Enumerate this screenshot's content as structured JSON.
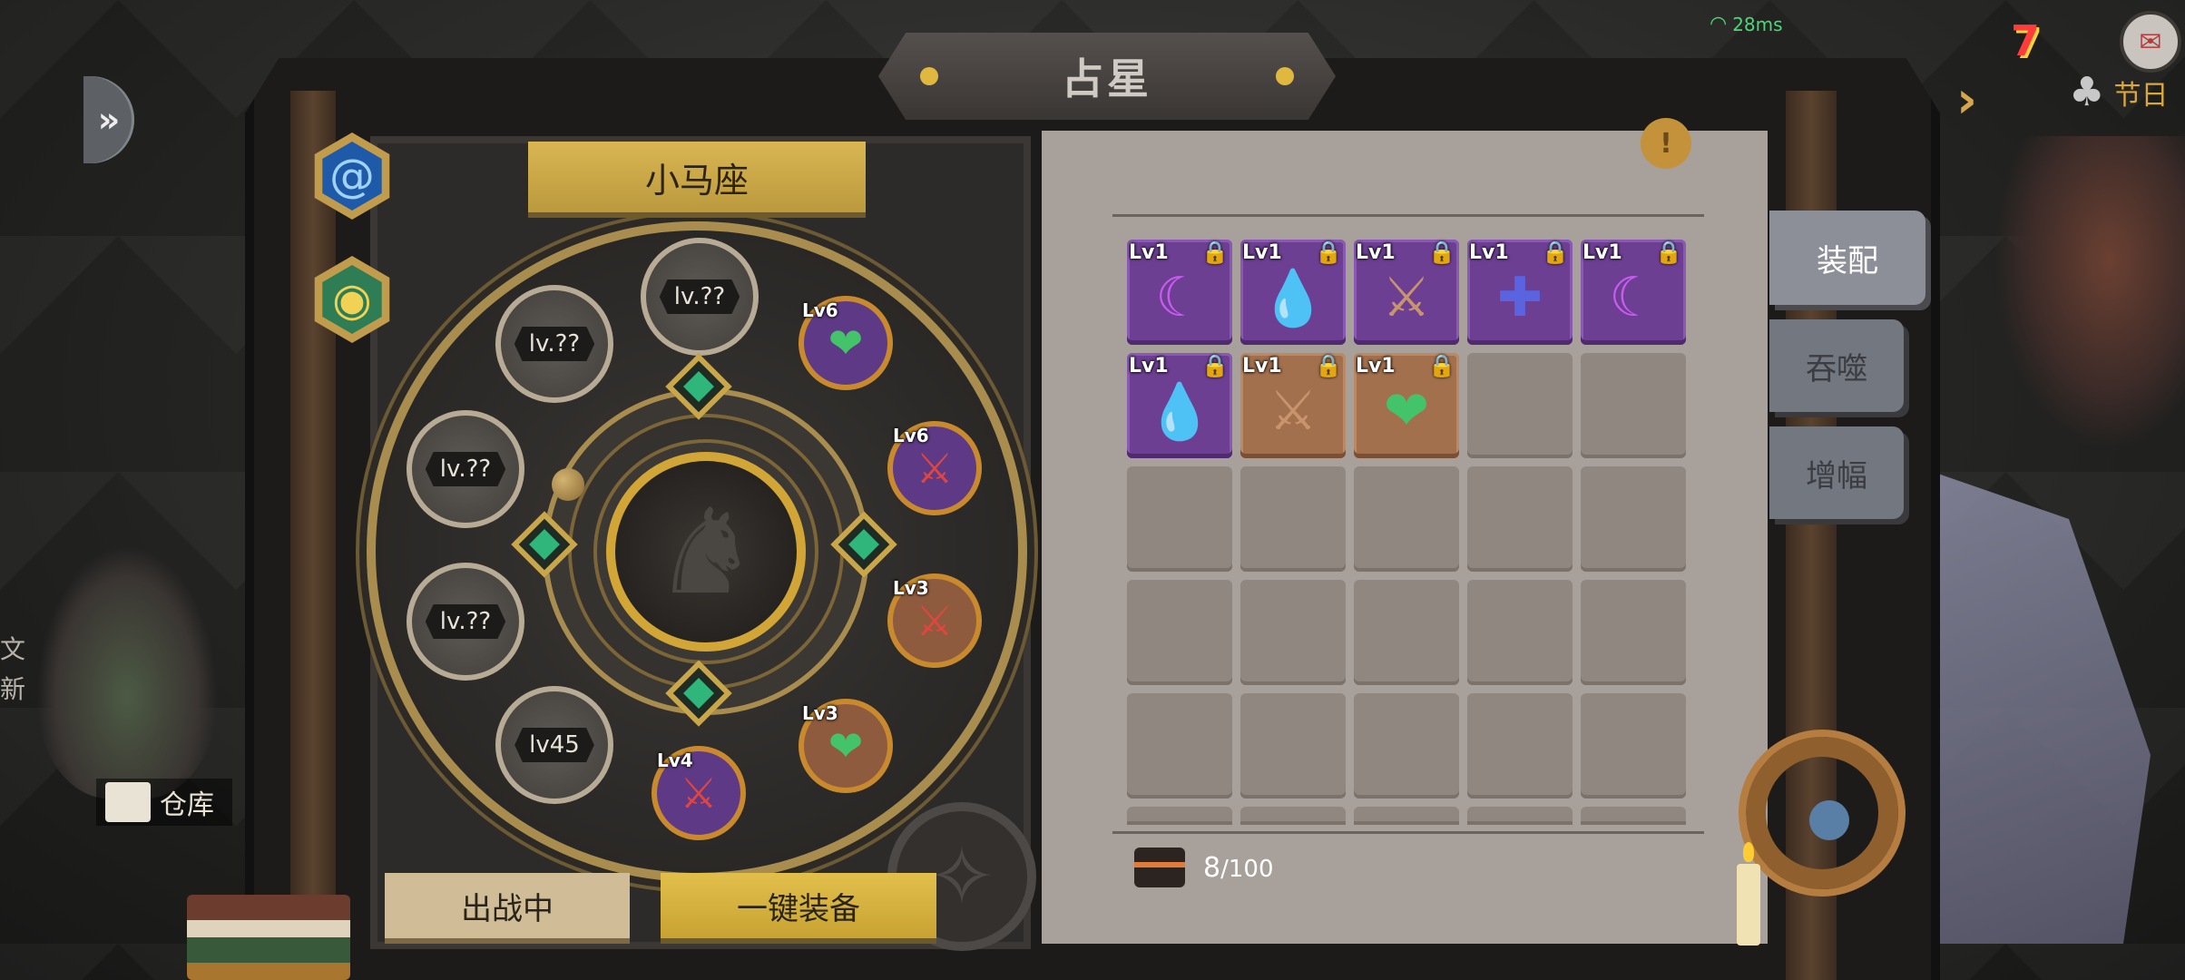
{
  "status": {
    "ping": "28ms"
  },
  "title": "占星",
  "constellation": {
    "name": "小马座"
  },
  "zodiac_slots": [
    {
      "label": "lv.??",
      "state": "locked"
    },
    {
      "label": "lv.??",
      "state": "locked"
    },
    {
      "label": "lv.??",
      "state": "locked"
    },
    {
      "label": "lv.??",
      "state": "locked"
    },
    {
      "label": "lv45",
      "state": "locked"
    }
  ],
  "equipped_gems": [
    {
      "level": "Lv6",
      "color": "green",
      "icon": "heart-gem-icon"
    },
    {
      "level": "Lv6",
      "color": "red",
      "icon": "sword-gem-icon"
    },
    {
      "level": "Lv3",
      "color": "red",
      "icon": "sword-gem-icon"
    },
    {
      "level": "Lv3",
      "color": "green",
      "icon": "heart-gem-icon"
    },
    {
      "level": "Lv4",
      "color": "red",
      "icon": "sword-gem-icon"
    }
  ],
  "buttons": {
    "in_battle": "出战中",
    "equip_all": "一键装备"
  },
  "tabs": {
    "equip": "装配",
    "devour": "吞噬",
    "amplify": "增幅"
  },
  "inventory": {
    "items": [
      {
        "level": "Lv1",
        "frame": "purple",
        "icon": "moon-gem-icon",
        "locked": true
      },
      {
        "level": "Lv1",
        "frame": "purple",
        "icon": "water-drop-gem-icon",
        "locked": true
      },
      {
        "level": "Lv1",
        "frame": "purple",
        "icon": "sword-gem-icon",
        "locked": true
      },
      {
        "level": "Lv1",
        "frame": "purple",
        "icon": "cross-gem-icon",
        "locked": true
      },
      {
        "level": "Lv1",
        "frame": "purple",
        "icon": "moon-gem-icon",
        "locked": true
      },
      {
        "level": "Lv1",
        "frame": "purple",
        "icon": "water-drop-gem-icon",
        "locked": true
      },
      {
        "level": "Lv1",
        "frame": "brown",
        "icon": "sword-gem-icon",
        "locked": true
      },
      {
        "level": "Lv1",
        "frame": "brown",
        "icon": "heart-gem-icon",
        "locked": true
      }
    ],
    "count": "8",
    "capacity": "/100"
  },
  "side": {
    "warehouse": "仓库",
    "festival": "节日"
  },
  "colors": {
    "gold": "#d9b652",
    "panel": "#a8a09a",
    "purple_frame": "#6d3f93",
    "brown_frame": "#a3704d"
  }
}
